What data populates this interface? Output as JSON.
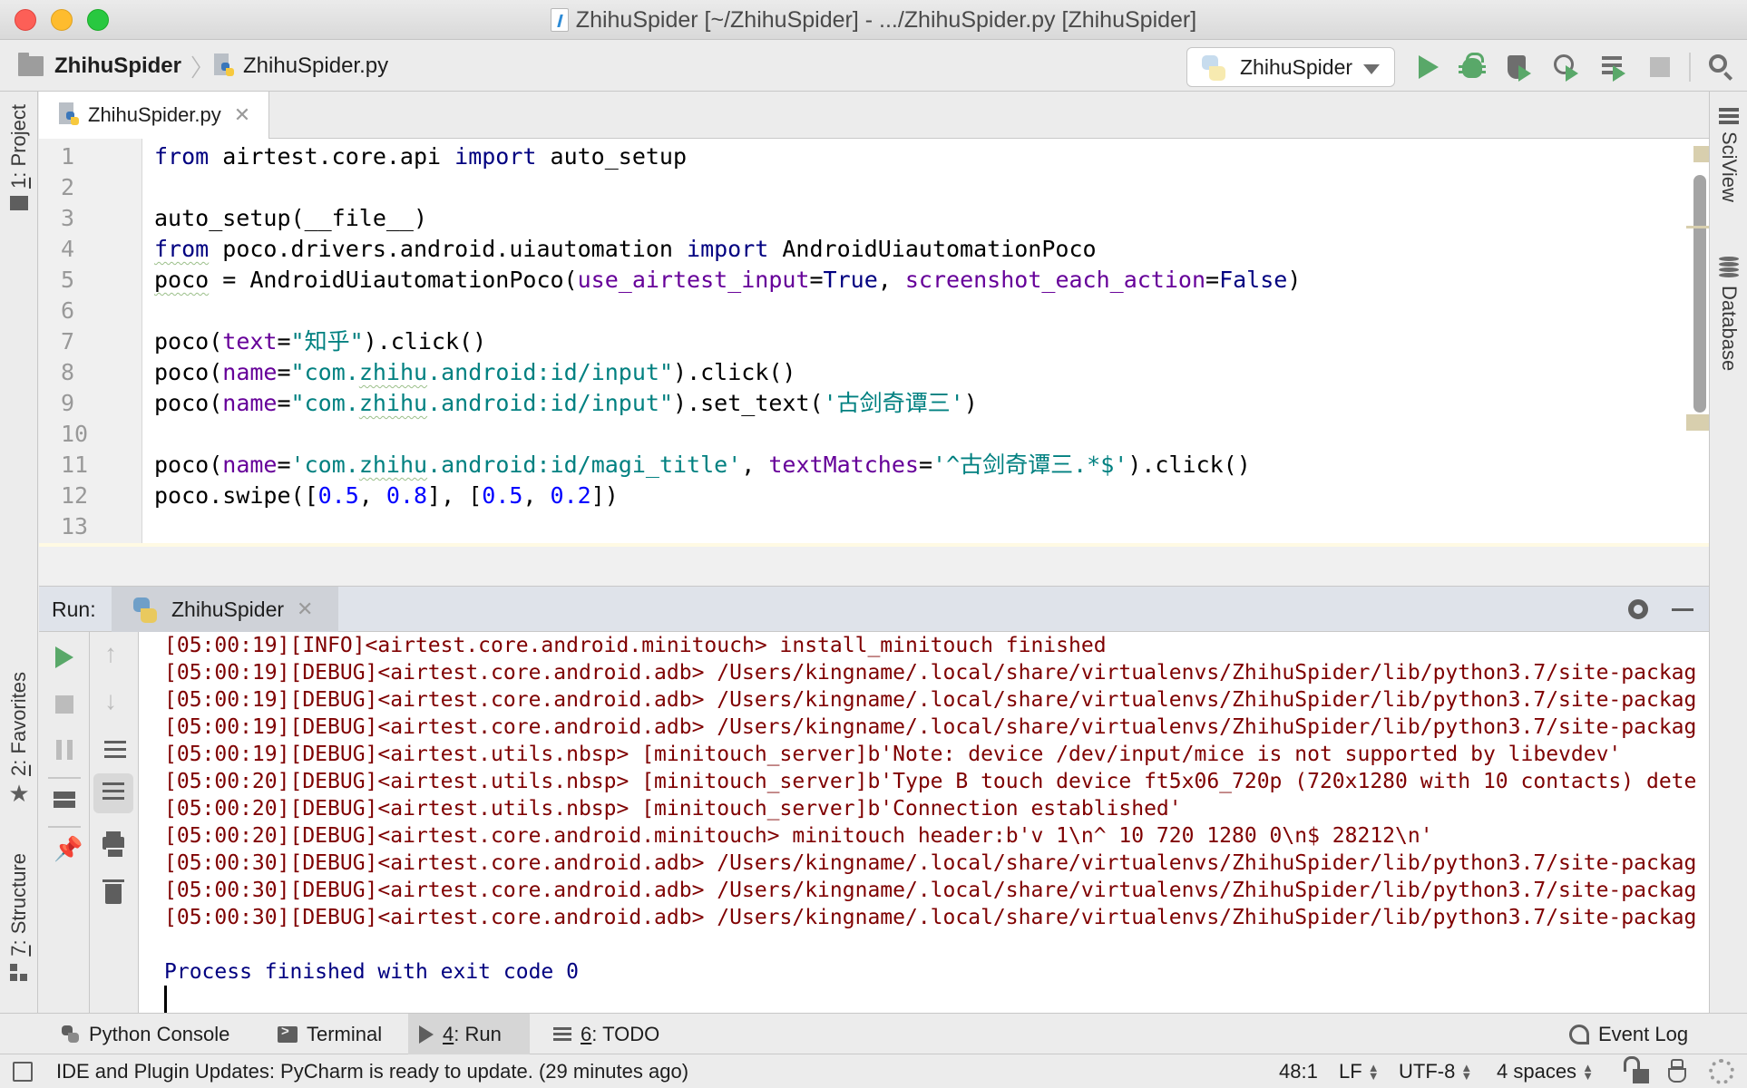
{
  "window": {
    "title": "ZhihuSpider [~/ZhihuSpider] - .../ZhihuSpider.py [ZhihuSpider]"
  },
  "breadcrumb": {
    "project": "ZhihuSpider",
    "file": "ZhihuSpider.py"
  },
  "toolbar": {
    "run_config": "ZhihuSpider",
    "buttons": [
      "run-icon",
      "debug-icon",
      "coverage-icon",
      "profile-icon",
      "concurrency-icon",
      "stop-icon",
      "search-icon"
    ]
  },
  "left_strip": {
    "project_tab": {
      "num": "1",
      "label": ": Project"
    },
    "favorites_tab": {
      "num": "2",
      "label": ": Favorites"
    },
    "structure_tab": {
      "num": "7",
      "label": ": Structure"
    }
  },
  "right_strip": {
    "sciview": "SciView",
    "database": "Database"
  },
  "editor": {
    "tab_label": "ZhihuSpider.py",
    "line_numbers": [
      "1",
      "2",
      "3",
      "4",
      "5",
      "6",
      "7",
      "8",
      "9",
      "10",
      "11",
      "12",
      "13"
    ],
    "lines": [
      [
        {
          "t": "from",
          "c": "kw"
        },
        {
          "t": " airtest.core.api "
        },
        {
          "t": "import",
          "c": "kw"
        },
        {
          "t": " auto_setup"
        }
      ],
      [],
      [
        {
          "t": "auto_setup(__file__)"
        }
      ],
      [
        {
          "t": "from",
          "c": "kw squig"
        },
        {
          "t": " poco.drivers.android.uiautomation "
        },
        {
          "t": "import",
          "c": "kw"
        },
        {
          "t": " AndroidUiautomationPoco"
        }
      ],
      [
        {
          "t": "poco",
          "c": "squig"
        },
        {
          "t": " = AndroidUiautomationPoco("
        },
        {
          "t": "use_airtest_input",
          "c": "param"
        },
        {
          "t": "="
        },
        {
          "t": "True",
          "c": "kw"
        },
        {
          "t": ", "
        },
        {
          "t": "screenshot_each_action",
          "c": "param"
        },
        {
          "t": "="
        },
        {
          "t": "False",
          "c": "kw"
        },
        {
          "t": ")"
        }
      ],
      [],
      [
        {
          "t": "poco("
        },
        {
          "t": "text",
          "c": "param"
        },
        {
          "t": "="
        },
        {
          "t": "\"知乎\"",
          "c": "str"
        },
        {
          "t": ").click()"
        }
      ],
      [
        {
          "t": "poco("
        },
        {
          "t": "name",
          "c": "param"
        },
        {
          "t": "="
        },
        {
          "t": "\"com.",
          "c": "str"
        },
        {
          "t": "zhihu",
          "c": "str squig"
        },
        {
          "t": ".android:id/input\"",
          "c": "str"
        },
        {
          "t": ").click()"
        }
      ],
      [
        {
          "t": "poco("
        },
        {
          "t": "name",
          "c": "param"
        },
        {
          "t": "="
        },
        {
          "t": "\"com.",
          "c": "str"
        },
        {
          "t": "zhihu",
          "c": "str squig"
        },
        {
          "t": ".android:id/input\"",
          "c": "str"
        },
        {
          "t": ").set_text("
        },
        {
          "t": "'古剑奇谭三'",
          "c": "str"
        },
        {
          "t": ")"
        }
      ],
      [],
      [
        {
          "t": "poco("
        },
        {
          "t": "name",
          "c": "param"
        },
        {
          "t": "="
        },
        {
          "t": "'com.",
          "c": "str"
        },
        {
          "t": "zhihu",
          "c": "str squig"
        },
        {
          "t": ".android:id/magi_title'",
          "c": "str"
        },
        {
          "t": ", "
        },
        {
          "t": "textMatches",
          "c": "param"
        },
        {
          "t": "="
        },
        {
          "t": "'^古剑奇谭三.*$'",
          "c": "str"
        },
        {
          "t": ").click()"
        }
      ],
      [
        {
          "t": "poco.swipe(["
        },
        {
          "t": "0.5",
          "c": "num"
        },
        {
          "t": ", "
        },
        {
          "t": "0.8",
          "c": "num"
        },
        {
          "t": "], ["
        },
        {
          "t": "0.5",
          "c": "num"
        },
        {
          "t": ", "
        },
        {
          "t": "0.2",
          "c": "num"
        },
        {
          "t": "])"
        }
      ],
      []
    ]
  },
  "run_panel": {
    "label": "Run:",
    "tab_label": "ZhihuSpider",
    "console_lines": [
      "[05:00:19][INFO]<airtest.core.android.minitouch> install_minitouch finished",
      "[05:00:19][DEBUG]<airtest.core.android.adb> /Users/kingname/.local/share/virtualenvs/ZhihuSpider/lib/python3.7/site-packag",
      "[05:00:19][DEBUG]<airtest.core.android.adb> /Users/kingname/.local/share/virtualenvs/ZhihuSpider/lib/python3.7/site-packag",
      "[05:00:19][DEBUG]<airtest.core.android.adb> /Users/kingname/.local/share/virtualenvs/ZhihuSpider/lib/python3.7/site-packag",
      "[05:00:19][DEBUG]<airtest.utils.nbsp> [minitouch_server]b'Note: device /dev/input/mice is not supported by libevdev'",
      "[05:00:20][DEBUG]<airtest.utils.nbsp> [minitouch_server]b'Type B touch device ft5x06_720p (720x1280 with 10 contacts) dete",
      "[05:00:20][DEBUG]<airtest.utils.nbsp> [minitouch_server]b'Connection established'",
      "[05:00:20][DEBUG]<airtest.core.android.minitouch> minitouch header:b'v 1\\n^ 10 720 1280 0\\n$ 28212\\n'",
      "[05:00:30][DEBUG]<airtest.core.android.adb> /Users/kingname/.local/share/virtualenvs/ZhihuSpider/lib/python3.7/site-packag",
      "[05:00:30][DEBUG]<airtest.core.android.adb> /Users/kingname/.local/share/virtualenvs/ZhihuSpider/lib/python3.7/site-packag",
      "[05:00:30][DEBUG]<airtest.core.android.adb> /Users/kingname/.local/share/virtualenvs/ZhihuSpider/lib/python3.7/site-packag"
    ],
    "exit_message": "Process finished with exit code 0"
  },
  "bottom_tabs": {
    "python_console": "Python Console",
    "terminal": "Terminal",
    "run_num": "4",
    "run_label": ": Run",
    "todo_num": "6",
    "todo_label": ": TODO",
    "event_log": "Event Log"
  },
  "statusbar": {
    "message": "IDE and Plugin Updates: PyCharm is ready to update. (29 minutes ago)",
    "position": "48:1",
    "line_ending": "LF",
    "encoding": "UTF-8",
    "indent": "4 spaces"
  },
  "colors": {
    "keyword": "#000080",
    "param": "#660099",
    "string": "#008080",
    "number": "#0000ff",
    "console_text": "#7f0000",
    "run_green": "#59a869"
  }
}
